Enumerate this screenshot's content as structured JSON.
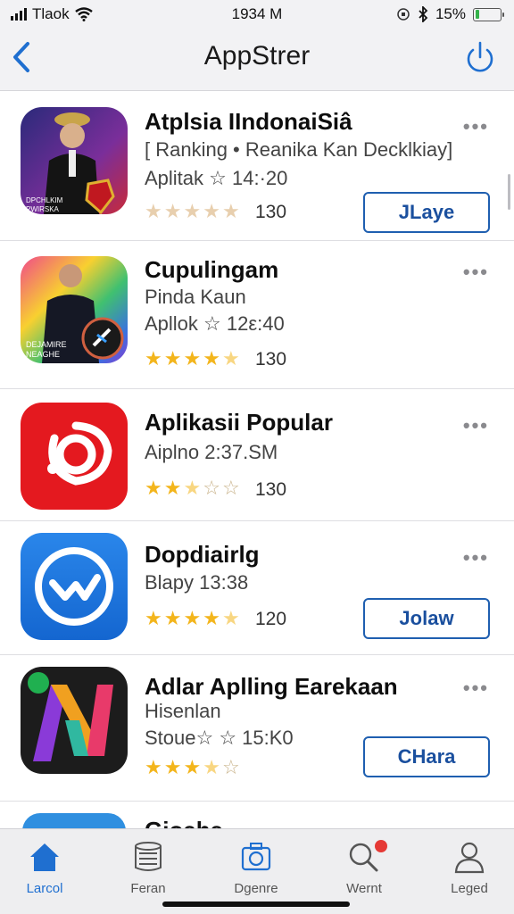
{
  "status_bar": {
    "carrier": "Tlaok",
    "time": "1934 M",
    "battery": "15%",
    "battery_level": 0.15
  },
  "header": {
    "title": "AppStrer",
    "back_icon": "chevron-left-icon",
    "power_icon": "power-icon"
  },
  "apps": [
    {
      "name": "Atplsia IIndonaiSiâ",
      "line1": "[ Ranking  •  Reanika Kan Decklkiay]",
      "line2": "Aplitak ☆ 14:·20",
      "rating": 0,
      "rating_count": "130",
      "button": "JLaye",
      "icon_text": "DPCHLKIM PWIRSKA"
    },
    {
      "name": "Cupulingam",
      "line1": "Pinda Kaun",
      "line2": "Apllok ☆ 12ε:40",
      "rating": 4.5,
      "rating_count": "130",
      "button": "",
      "icon_text": "DEJAMIRE NEAGHE"
    },
    {
      "name": "Aplikasii Popular",
      "line1": "Aiplno 2:37.SM",
      "line2": "",
      "rating": 2.5,
      "rating_count": "130",
      "button": "",
      "icon_text": ""
    },
    {
      "name": "Dopdiairlg",
      "line1": "Blapy 13:38",
      "line2": "",
      "rating": 4.5,
      "rating_count": "120",
      "button": "Jolaw",
      "icon_text": ""
    },
    {
      "name": "Adlar Aplling Earekaan",
      "line1": "Hisenlan",
      "line2": "Stoue☆ ☆ 15:K0",
      "rating": 3.5,
      "rating_count": "",
      "button": "CHara",
      "icon_text": ""
    }
  ],
  "partial_row": {
    "name": "Gioaha"
  },
  "tabs": [
    {
      "label": "Larcol",
      "icon": "home-icon",
      "active": true
    },
    {
      "label": "Feran",
      "icon": "database-icon",
      "active": false
    },
    {
      "label": "Dgenre",
      "icon": "camera-icon",
      "active": false
    },
    {
      "label": "Wernt",
      "icon": "search-icon",
      "active": false,
      "badge": true
    },
    {
      "label": "Leged",
      "icon": "person-icon",
      "active": false
    }
  ],
  "colors": {
    "accent": "#1f6fd0",
    "button_border": "#1f5fb0",
    "star_gold": "#f3b51c",
    "star_faded": "#e8cfae",
    "badge_red": "#e53935"
  }
}
